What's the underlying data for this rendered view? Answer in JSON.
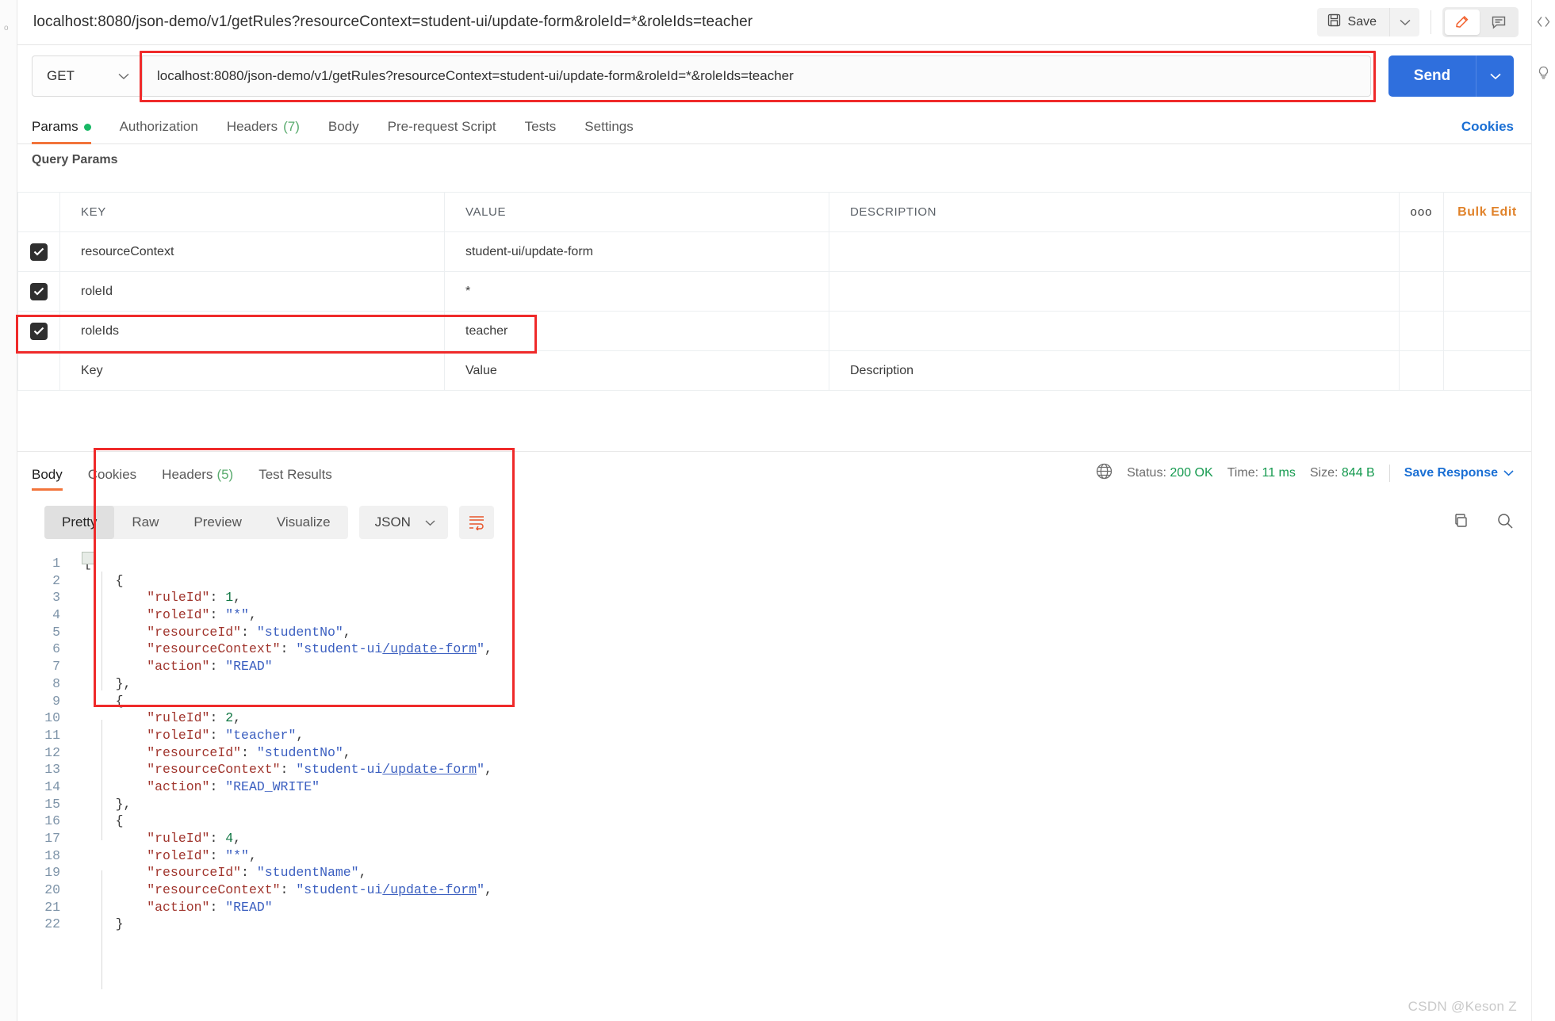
{
  "header": {
    "request_title": "localhost:8080/json-demo/v1/getRules?resourceContext=student-ui/update-form&roleId=*&roleIds=teacher",
    "save_label": "Save"
  },
  "urlbar": {
    "method": "GET",
    "url": "localhost:8080/json-demo/v1/getRules?resourceContext=student-ui/update-form&roleId=*&roleIds=teacher",
    "send_label": "Send"
  },
  "request_tabs": [
    {
      "label": "Params",
      "badge": "dot",
      "active": true
    },
    {
      "label": "Authorization",
      "badge": "",
      "active": false
    },
    {
      "label": "Headers",
      "badge": "(7)",
      "active": false
    },
    {
      "label": "Body",
      "badge": "",
      "active": false
    },
    {
      "label": "Pre-request Script",
      "badge": "",
      "active": false
    },
    {
      "label": "Tests",
      "badge": "",
      "active": false
    },
    {
      "label": "Settings",
      "badge": "",
      "active": false
    }
  ],
  "cookies_link": "Cookies",
  "params": {
    "section_label": "Query Params",
    "columns": {
      "key": "KEY",
      "value": "VALUE",
      "description": "DESCRIPTION"
    },
    "dots_label": "ooo",
    "bulk_edit_label": "Bulk Edit",
    "rows": [
      {
        "checked": true,
        "key": "resourceContext",
        "value": "student-ui/update-form",
        "description": "",
        "highlight": false
      },
      {
        "checked": true,
        "key": "roleId",
        "value": "*",
        "description": "",
        "highlight": false
      },
      {
        "checked": true,
        "key": "roleIds",
        "value": "teacher",
        "description": "",
        "highlight": true
      }
    ],
    "placeholder_row": {
      "key": "Key",
      "value": "Value",
      "description": "Description"
    }
  },
  "response": {
    "tabs": [
      {
        "label": "Body",
        "badge": "",
        "active": true
      },
      {
        "label": "Cookies",
        "badge": "",
        "active": false
      },
      {
        "label": "Headers",
        "badge": "(5)",
        "active": false
      },
      {
        "label": "Test Results",
        "badge": "",
        "active": false
      }
    ],
    "status_label": "Status:",
    "status_value": "200 OK",
    "time_label": "Time:",
    "time_value": "11 ms",
    "size_label": "Size:",
    "size_value": "844 B",
    "save_response_label": "Save Response",
    "format_tabs": [
      {
        "label": "Pretty",
        "active": true
      },
      {
        "label": "Raw",
        "active": false
      },
      {
        "label": "Preview",
        "active": false
      },
      {
        "label": "Visualize",
        "active": false
      }
    ],
    "content_type": "JSON"
  },
  "code": {
    "line_numbers": [
      1,
      2,
      3,
      4,
      5,
      6,
      7,
      8,
      9,
      10,
      11,
      12,
      13,
      14,
      15,
      16,
      17,
      18,
      19,
      20,
      21,
      22
    ],
    "lines": [
      {
        "n": 1,
        "indent": 0,
        "tokens": [
          {
            "t": "[",
            "c": "p"
          }
        ]
      },
      {
        "n": 2,
        "indent": 1,
        "tokens": [
          {
            "t": "{",
            "c": "p"
          }
        ]
      },
      {
        "n": 3,
        "indent": 2,
        "tokens": [
          {
            "t": "\"ruleId\"",
            "c": "k"
          },
          {
            "t": ": ",
            "c": "p"
          },
          {
            "t": "1",
            "c": "n"
          },
          {
            "t": ",",
            "c": "p"
          }
        ]
      },
      {
        "n": 4,
        "indent": 2,
        "tokens": [
          {
            "t": "\"roleId\"",
            "c": "k"
          },
          {
            "t": ": ",
            "c": "p"
          },
          {
            "t": "\"*\"",
            "c": "s"
          },
          {
            "t": ",",
            "c": "p"
          }
        ]
      },
      {
        "n": 5,
        "indent": 2,
        "tokens": [
          {
            "t": "\"resourceId\"",
            "c": "k"
          },
          {
            "t": ": ",
            "c": "p"
          },
          {
            "t": "\"studentNo\"",
            "c": "s"
          },
          {
            "t": ",",
            "c": "p"
          }
        ]
      },
      {
        "n": 6,
        "indent": 2,
        "tokens": [
          {
            "t": "\"resourceContext\"",
            "c": "k"
          },
          {
            "t": ": ",
            "c": "p"
          },
          {
            "t": "\"student-ui",
            "c": "s"
          },
          {
            "t": "/update-form",
            "c": "s u"
          },
          {
            "t": "\"",
            "c": "s"
          },
          {
            "t": ",",
            "c": "p"
          }
        ]
      },
      {
        "n": 7,
        "indent": 2,
        "tokens": [
          {
            "t": "\"action\"",
            "c": "k"
          },
          {
            "t": ": ",
            "c": "p"
          },
          {
            "t": "\"READ\"",
            "c": "s"
          }
        ]
      },
      {
        "n": 8,
        "indent": 1,
        "tokens": [
          {
            "t": "},",
            "c": "p"
          }
        ]
      },
      {
        "n": 9,
        "indent": 1,
        "tokens": [
          {
            "t": "{",
            "c": "p"
          }
        ]
      },
      {
        "n": 10,
        "indent": 2,
        "tokens": [
          {
            "t": "\"ruleId\"",
            "c": "k"
          },
          {
            "t": ": ",
            "c": "p"
          },
          {
            "t": "2",
            "c": "n"
          },
          {
            "t": ",",
            "c": "p"
          }
        ]
      },
      {
        "n": 11,
        "indent": 2,
        "tokens": [
          {
            "t": "\"roleId\"",
            "c": "k"
          },
          {
            "t": ": ",
            "c": "p"
          },
          {
            "t": "\"teacher\"",
            "c": "s"
          },
          {
            "t": ",",
            "c": "p"
          }
        ]
      },
      {
        "n": 12,
        "indent": 2,
        "tokens": [
          {
            "t": "\"resourceId\"",
            "c": "k"
          },
          {
            "t": ": ",
            "c": "p"
          },
          {
            "t": "\"studentNo\"",
            "c": "s"
          },
          {
            "t": ",",
            "c": "p"
          }
        ]
      },
      {
        "n": 13,
        "indent": 2,
        "tokens": [
          {
            "t": "\"resourceContext\"",
            "c": "k"
          },
          {
            "t": ": ",
            "c": "p"
          },
          {
            "t": "\"student-ui",
            "c": "s"
          },
          {
            "t": "/update-form",
            "c": "s u"
          },
          {
            "t": "\"",
            "c": "s"
          },
          {
            "t": ",",
            "c": "p"
          }
        ]
      },
      {
        "n": 14,
        "indent": 2,
        "tokens": [
          {
            "t": "\"action\"",
            "c": "k"
          },
          {
            "t": ": ",
            "c": "p"
          },
          {
            "t": "\"READ_WRITE\"",
            "c": "s"
          }
        ]
      },
      {
        "n": 15,
        "indent": 1,
        "tokens": [
          {
            "t": "},",
            "c": "p"
          }
        ]
      },
      {
        "n": 16,
        "indent": 1,
        "tokens": [
          {
            "t": "{",
            "c": "p"
          }
        ]
      },
      {
        "n": 17,
        "indent": 2,
        "tokens": [
          {
            "t": "\"ruleId\"",
            "c": "k"
          },
          {
            "t": ": ",
            "c": "p"
          },
          {
            "t": "4",
            "c": "n"
          },
          {
            "t": ",",
            "c": "p"
          }
        ]
      },
      {
        "n": 18,
        "indent": 2,
        "tokens": [
          {
            "t": "\"roleId\"",
            "c": "k"
          },
          {
            "t": ": ",
            "c": "p"
          },
          {
            "t": "\"*\"",
            "c": "s"
          },
          {
            "t": ",",
            "c": "p"
          }
        ]
      },
      {
        "n": 19,
        "indent": 2,
        "tokens": [
          {
            "t": "\"resourceId\"",
            "c": "k"
          },
          {
            "t": ": ",
            "c": "p"
          },
          {
            "t": "\"studentName\"",
            "c": "s"
          },
          {
            "t": ",",
            "c": "p"
          }
        ]
      },
      {
        "n": 20,
        "indent": 2,
        "tokens": [
          {
            "t": "\"resourceContext\"",
            "c": "k"
          },
          {
            "t": ": ",
            "c": "p"
          },
          {
            "t": "\"student-ui",
            "c": "s"
          },
          {
            "t": "/update-form",
            "c": "s u"
          },
          {
            "t": "\"",
            "c": "s"
          },
          {
            "t": ",",
            "c": "p"
          }
        ]
      },
      {
        "n": 21,
        "indent": 2,
        "tokens": [
          {
            "t": "\"action\"",
            "c": "k"
          },
          {
            "t": ": ",
            "c": "p"
          },
          {
            "t": "\"READ\"",
            "c": "s"
          }
        ]
      },
      {
        "n": 22,
        "indent": 1,
        "tokens": [
          {
            "t": "}",
            "c": "p"
          }
        ]
      }
    ]
  },
  "watermark": "CSDN @Keson Z",
  "colors": {
    "accent_orange": "#f2743b",
    "send_blue": "#2f6fdd",
    "link_blue": "#1a6fd4",
    "status_green": "#159a4f",
    "highlight_red": "#ef2a2a",
    "bulk_edit_orange": "#e0822a"
  }
}
